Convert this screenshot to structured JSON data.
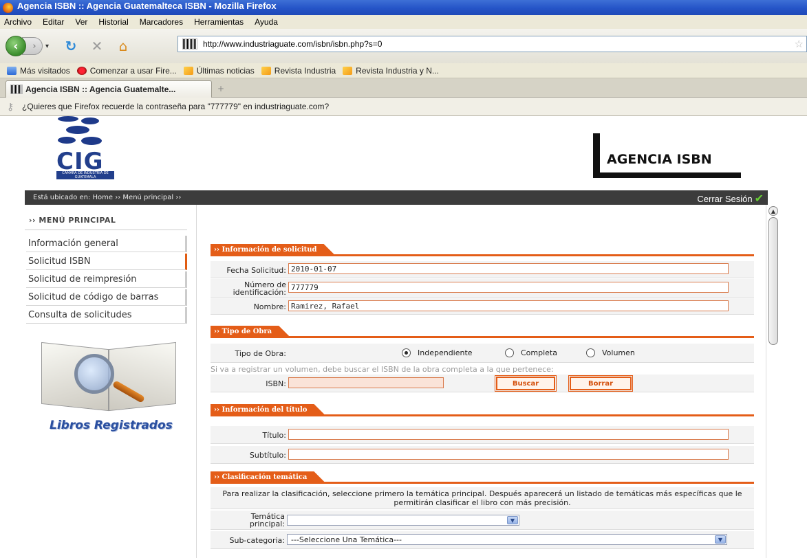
{
  "browser": {
    "window_title": "Agencia ISBN :: Agencia Guatemalteca ISBN - Mozilla Firefox",
    "menu": [
      "Archivo",
      "Editar",
      "Ver",
      "Historial",
      "Marcadores",
      "Herramientas",
      "Ayuda"
    ],
    "url": "http://www.industriaguate.com/isbn/isbn.php?s=0",
    "bookmarks": [
      "Más visitados",
      "Comenzar a usar Fire...",
      "Últimas noticias",
      "Revista Industria",
      "Revista Industria y N..."
    ],
    "tab_title": "Agencia ISBN :: Agencia Guatemalte...",
    "notification": "¿Quieres que Firefox recuerde la contraseña para \"777779\" en industriaguate.com?",
    "icons": [
      "back-icon",
      "forward-icon",
      "reload-icon",
      "stop-icon",
      "home-icon",
      "bookmark-star-icon",
      "key-icon"
    ]
  },
  "header": {
    "logo_letters": "CIG",
    "logo_sub": "CAMARA DE INDUSTRIA DE GUATEMALA",
    "agency_label": "AGENCIA ISBN"
  },
  "breadcrumb": {
    "text": "Está ubicado en: Home ›› Menú principal ››",
    "logout": "Cerrar Sesión"
  },
  "sidebar": {
    "title": "›› MENÚ PRINCIPAL",
    "items": [
      {
        "label": "Información general",
        "active": false
      },
      {
        "label": "Solicitud ISBN",
        "active": true
      },
      {
        "label": "Solicitud de reimpresión",
        "active": false
      },
      {
        "label": "Solicitud de código de barras",
        "active": false
      },
      {
        "label": "Consulta de solicitudes",
        "active": false
      }
    ],
    "banner": "Libros Registrados"
  },
  "form": {
    "sec_solicitud": "›› Información de solicitud",
    "fecha_label": "Fecha Solicitud:",
    "fecha_value": "2010-01-07",
    "numero_label_1": "Número de",
    "numero_label_2": "identificación:",
    "numero_value": "777779",
    "nombre_label": "Nombre:",
    "nombre_value": "Ramirez, Rafael",
    "sec_obra": "›› Tipo de Obra",
    "tipo_label": "Tipo de Obra:",
    "tipo_options": [
      "Independiente",
      "Completa",
      "Volumen"
    ],
    "tipo_selected": "Independiente",
    "hint": "Si va a registrar un volumen, debe buscar el ISBN de la obra completa a la que pertenece:",
    "isbn_label": "ISBN:",
    "isbn_value": "",
    "buscar": "Buscar",
    "borrar": "Borrar",
    "sec_titulo": "›› Información del título",
    "titulo_label": "Título:",
    "titulo_value": "",
    "subtitulo_label": "Subtítulo:",
    "subtitulo_value": "",
    "sec_clasif": "›› Clasificación temática",
    "clasif_info": "Para realizar la clasificación, seleccione primero la temática principal. Después aparecerá un listado de temáticas más específicas que le permitirán clasificar el libro con más precisión.",
    "tematica_label_1": "Temática",
    "tematica_label_2": "principal:",
    "tematica_value": "",
    "subcat_label": "Sub-categoria:",
    "subcat_value": "---Seleccione Una Temática---"
  },
  "colors": {
    "accent": "#e45d18",
    "crumb_bg": "#3c3c3c",
    "titlebar": "#2554c7"
  }
}
